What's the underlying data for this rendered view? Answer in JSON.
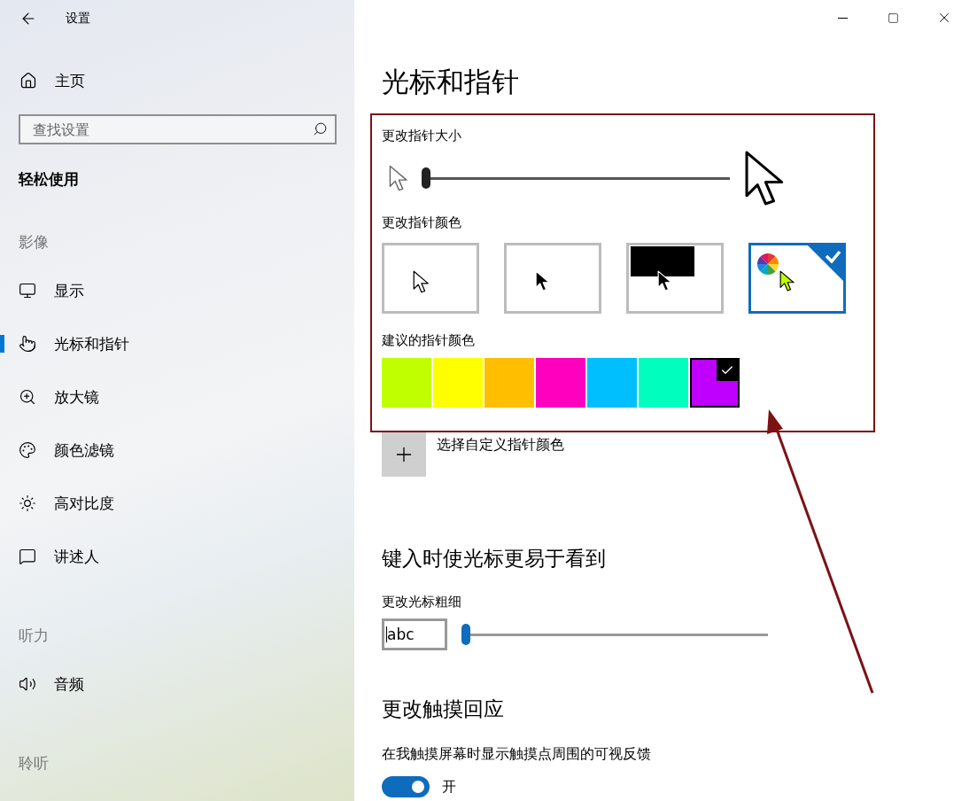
{
  "window": {
    "title": "设置"
  },
  "sidebar": {
    "home": "主页",
    "search": {
      "placeholder": "查找设置"
    },
    "category": "轻松使用",
    "groups": [
      {
        "title": "影像",
        "items": [
          {
            "label": "显示",
            "selected": false
          },
          {
            "label": "光标和指针",
            "selected": true
          },
          {
            "label": "放大镜",
            "selected": false
          },
          {
            "label": "颜色滤镜",
            "selected": false
          },
          {
            "label": "高对比度",
            "selected": false
          },
          {
            "label": "讲述人",
            "selected": false
          }
        ]
      },
      {
        "title": "听力",
        "items": [
          {
            "label": "音频",
            "selected": false
          }
        ]
      },
      {
        "title": "聆听"
      }
    ]
  },
  "page": {
    "title": "光标和指针",
    "pointer_size": {
      "label": "更改指针大小",
      "level": 0
    },
    "pointer_color": {
      "label": "更改指针颜色",
      "options": [
        {
          "kind": "white",
          "selected": false
        },
        {
          "kind": "black",
          "selected": false
        },
        {
          "kind": "inverted",
          "selected": false
        },
        {
          "kind": "custom",
          "selected": true
        }
      ]
    },
    "suggested_colors": {
      "label": "建议的指针颜色",
      "swatches": [
        {
          "color": "#bfff00",
          "selected": false
        },
        {
          "color": "#ffff00",
          "selected": false
        },
        {
          "color": "#ffbf00",
          "selected": false
        },
        {
          "color": "#ff00bf",
          "selected": false
        },
        {
          "color": "#00bfff",
          "selected": false
        },
        {
          "color": "#00ffbf",
          "selected": false
        },
        {
          "color": "#bf00ff",
          "selected": true
        }
      ]
    },
    "custom_color": {
      "label": "选择自定义指针颜色"
    },
    "text_cursor": {
      "title": "键入时使光标更易于看到",
      "label": "更改光标粗细",
      "preview": "abc",
      "level": 0
    },
    "touch": {
      "title": "更改触摸回应",
      "label": "在我触摸屏幕时显示触摸点周围的可视反馈",
      "on": true,
      "state": "开"
    }
  }
}
